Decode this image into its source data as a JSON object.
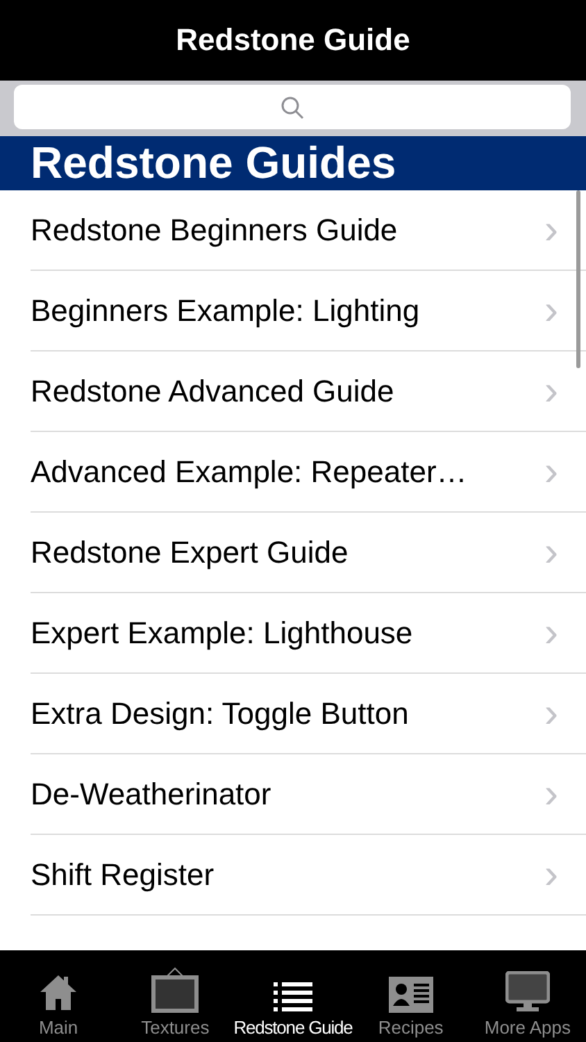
{
  "navbar": {
    "title": "Redstone Guide"
  },
  "section": {
    "title": "Redstone Guides"
  },
  "rows": [
    {
      "label": "Redstone Beginners Guide",
      "chevron": "›"
    },
    {
      "label": "Beginners Example: Lighting",
      "chevron": "›"
    },
    {
      "label": "Redstone Advanced Guide",
      "chevron": "›"
    },
    {
      "label": "Advanced Example: Repeater…",
      "chevron": "›"
    },
    {
      "label": "Redstone Expert Guide",
      "chevron": "›"
    },
    {
      "label": "Expert Example: Lighthouse",
      "chevron": "›"
    },
    {
      "label": "Extra Design: Toggle Button",
      "chevron": "›"
    },
    {
      "label": "De-Weatherinator",
      "chevron": "›"
    },
    {
      "label": "Shift Register",
      "chevron": "›"
    }
  ],
  "tabs": [
    {
      "label": "Main",
      "kind": "house",
      "selected": false
    },
    {
      "label": "Textures",
      "kind": "frame",
      "selected": false
    },
    {
      "label": "Redstone Guide",
      "kind": "list",
      "selected": true
    },
    {
      "label": "Recipes",
      "kind": "card",
      "selected": false
    },
    {
      "label": "More Apps",
      "kind": "monitor",
      "selected": false
    }
  ]
}
